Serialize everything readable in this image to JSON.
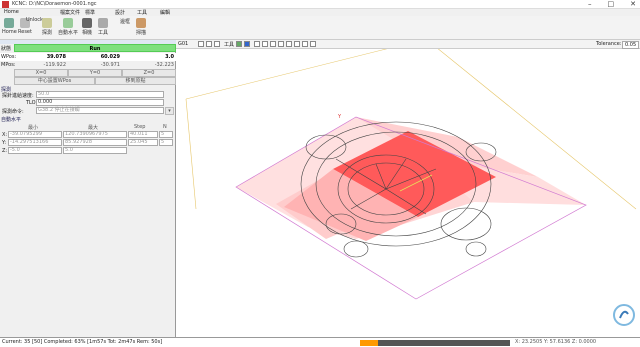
{
  "window": {
    "title": "KCNC: D:\\NC\\Doraemon-0001.ngc"
  },
  "menu": [
    "Home",
    "檔案文件",
    "標準",
    "設計",
    "工具",
    "編輯"
  ],
  "ribbon": {
    "buttons": [
      {
        "label": "Home",
        "icon": "home-icon"
      },
      {
        "label": "Reset",
        "icon": "reset-icon"
      },
      {
        "label": "Unlock",
        "icon": "unlock-icon"
      },
      {
        "label": "探測",
        "icon": "probe-icon"
      },
      {
        "label": "自動水平",
        "icon": "auto-level-icon"
      },
      {
        "label": "相機",
        "icon": "camera-icon"
      },
      {
        "label": "工具",
        "icon": "tool-icon"
      },
      {
        "label": "邊框",
        "icon": "frame-icon"
      },
      {
        "label": "掃描",
        "icon": "scan-icon"
      }
    ]
  },
  "status_panel": {
    "state_label": "狀態",
    "state": "Run",
    "wpos_label": "WPos:",
    "mpos_label": "MPos:",
    "wpos": [
      "39.078",
      "60.029",
      "3.0"
    ],
    "mpos": [
      "-119.922",
      "-30.971",
      "-32.223"
    ],
    "axis_buttons": [
      "X=0",
      "Y=0",
      "Z=0"
    ],
    "origin_buttons": [
      "中心設置WPos",
      "移到原點"
    ]
  },
  "probe": {
    "title": "探測",
    "feed_label": "探針進給速度:",
    "feed": "50.0",
    "tlo_label": "TLO:",
    "tlo": "0.000",
    "cmd_label": "探測命令:",
    "cmd": "G38.2 停止在接觸"
  },
  "autolevel": {
    "title": "自動水平",
    "headers": [
      "最小",
      "最大",
      "Step",
      "N"
    ],
    "rows": [
      {
        "axis": "X:",
        "min": "-39.0795299",
        "max": "120.7390967975",
        "step": "40.011",
        "n": "5"
      },
      {
        "axis": "Y:",
        "min": "-14.297513166",
        "max": "85.927928",
        "step": "25.045",
        "n": "5"
      },
      {
        "axis": "Z:",
        "min": "-5.0",
        "max": "5.0",
        "step": "",
        "n": ""
      }
    ]
  },
  "view_toolbar": {
    "code": "G01",
    "tool_label": "工具",
    "tolerance_label": "Tolerance:",
    "tolerance": "0.05"
  },
  "statusbar": {
    "text": "Current: 35 [50]   Completed: 63% [1m57s Tot: 2m47s Rem: 50s]",
    "progress": 0.12,
    "coords": "X: 23.2505  Y: 57.6136  Z: 0.0000"
  },
  "colors": {
    "run": "#7ee07e",
    "progress": "#ff9900",
    "heightmap_dark": "#ff5a5a",
    "heightmap_light": "#ffd5d5"
  }
}
